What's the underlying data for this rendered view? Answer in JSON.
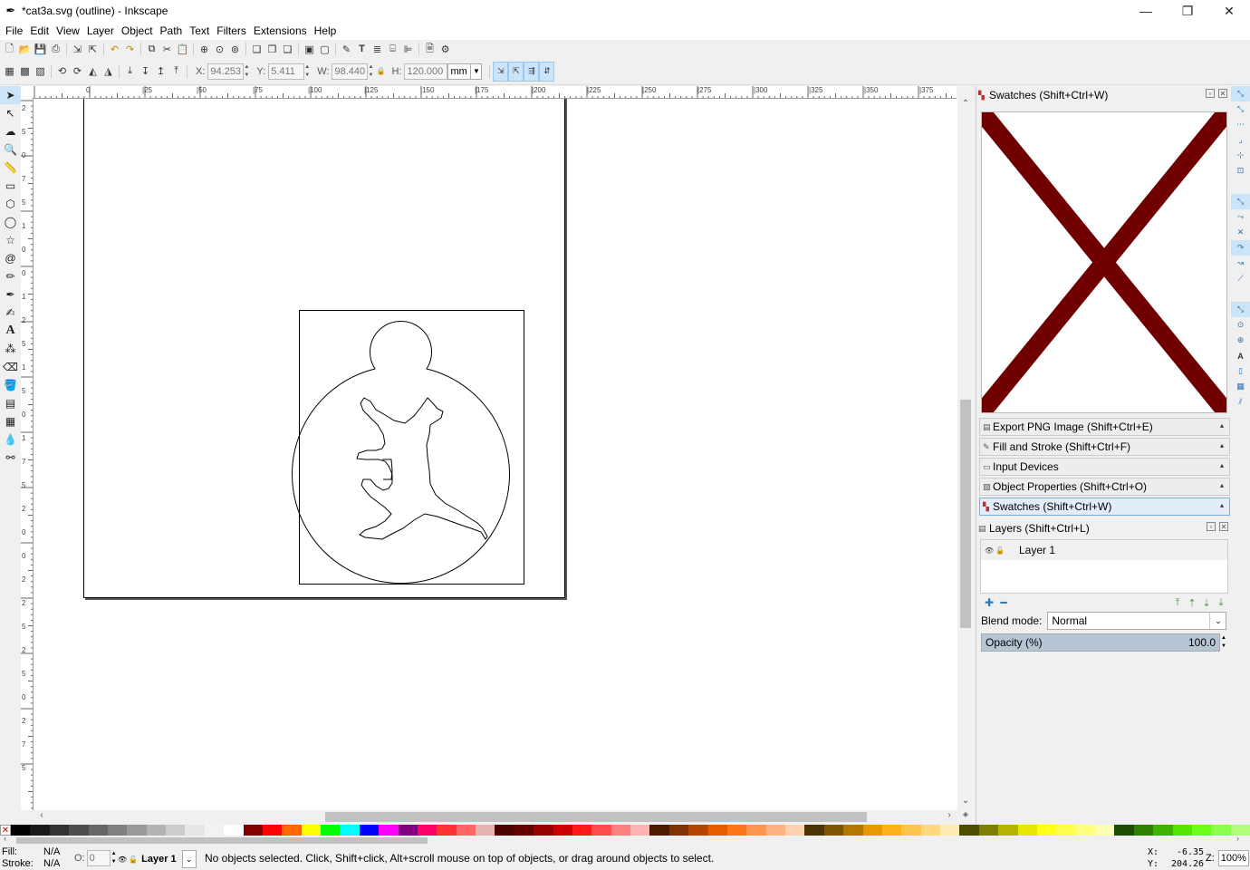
{
  "window": {
    "title": "*cat3a.svg (outline) - Inkscape",
    "app_icon": "inkscape-logo-icon",
    "controls": [
      "minimize-icon",
      "restore-icon",
      "close-icon"
    ]
  },
  "menubar": {
    "items": [
      {
        "label": "File",
        "accel": "F"
      },
      {
        "label": "Edit",
        "accel": "E"
      },
      {
        "label": "View",
        "accel": "V"
      },
      {
        "label": "Layer",
        "accel": "L"
      },
      {
        "label": "Object",
        "accel": "O"
      },
      {
        "label": "Path",
        "accel": "P"
      },
      {
        "label": "Text",
        "accel": "T"
      },
      {
        "label": "Filters",
        "accel": "r"
      },
      {
        "label": "Extensions",
        "accel": "x"
      },
      {
        "label": "Help",
        "accel": "H"
      }
    ]
  },
  "commandbar": {
    "icons": [
      "new-document-icon",
      "open-icon",
      "save-icon",
      "print-icon",
      "import-icon",
      "export-icon",
      "undo-icon",
      "redo-icon",
      "copy-icon",
      "cut-icon",
      "paste-icon",
      "zoom-selection-icon",
      "zoom-drawing-icon",
      "zoom-page-icon",
      "duplicate-icon",
      "clone-icon",
      "unlink-clone-icon",
      "group-icon",
      "ungroup-icon",
      "fill-stroke-icon",
      "text-font-icon",
      "layers-icon",
      "xml-editor-icon",
      "align-distribute-icon",
      "document-properties-icon",
      "preferences-icon"
    ]
  },
  "tool_controls": {
    "x_label": "X:",
    "x_value": "94.253",
    "y_label": "Y:",
    "y_value": "5.411",
    "w_label": "W:",
    "w_value": "98.440",
    "h_label": "H:",
    "h_value": "120.000",
    "unit": "mm"
  },
  "toolbox": {
    "tools": [
      "selector-tool-icon",
      "node-tool-icon",
      "tweak-tool-icon",
      "zoom-tool-icon",
      "measure-tool-icon",
      "rectangle-tool-icon",
      "3dbox-tool-icon",
      "ellipse-tool-icon",
      "star-tool-icon",
      "spiral-tool-icon",
      "pencil-tool-icon",
      "pen-tool-icon",
      "calligraphy-tool-icon",
      "text-tool-icon",
      "spray-tool-icon",
      "eraser-tool-icon",
      "paint-bucket-tool-icon",
      "gradient-tool-icon",
      "mesh-tool-icon",
      "dropper-tool-icon",
      "connector-tool-icon"
    ]
  },
  "ruler": {
    "h_labels": [
      "0",
      "|25",
      "|50",
      "|75",
      "|100",
      "|125",
      "|150",
      "|175",
      "|200",
      "|225",
      "|250",
      "|275",
      "|300",
      "|325",
      "|350",
      "|375"
    ],
    "v_labels": [
      "2",
      "5",
      "0",
      "7",
      "5",
      "1",
      "0",
      "0",
      "1",
      "2",
      "5",
      "1",
      "5",
      "0",
      "1",
      "7",
      "5",
      "2",
      "0",
      "0",
      "2",
      "2",
      "5",
      "2",
      "5",
      "0",
      "2",
      "7",
      "5"
    ]
  },
  "dock": {
    "swatches_title": "Swatches (Shift+Ctrl+W)",
    "collapsed_dialogs": [
      {
        "label": "Export PNG Image (Shift+Ctrl+E)",
        "icon": "export-png-icon"
      },
      {
        "label": "Fill and Stroke (Shift+Ctrl+F)",
        "icon": "fill-stroke-icon"
      },
      {
        "label": "Input Devices",
        "icon": "input-devices-icon"
      },
      {
        "label": "Object Properties (Shift+Ctrl+O)",
        "icon": "object-properties-icon"
      },
      {
        "label": "Swatches (Shift+Ctrl+W)",
        "icon": "swatches-icon"
      }
    ],
    "layers_title": "Layers (Shift+Ctrl+L)",
    "layers": [
      {
        "name": "Layer 1"
      }
    ],
    "blend_label": "Blend mode:",
    "blend_value": "Normal",
    "opacity_label": "Opacity (%)",
    "opacity_value": "100.0",
    "opacity_fraction": 1.0
  },
  "statusbar": {
    "fill_label": "Fill:",
    "stroke_label": "Stroke:",
    "fill_value": "N/A",
    "stroke_value": "N/A",
    "opacity_label": "O:",
    "opacity_value": "0",
    "layer_name": "Layer 1",
    "message": "No objects selected. Click, Shift+click, Alt+scroll mouse on top of objects, or drag around objects to select.",
    "x_label": "X:",
    "x_value": "-6.35",
    "y_label": "Y:",
    "y_value": "204.26",
    "zoom_label": "Z:",
    "zoom_value": "100%"
  },
  "palette": {
    "colors": [
      "#000000",
      "#1a1a1a",
      "#333333",
      "#4d4d4d",
      "#666666",
      "#808080",
      "#999999",
      "#b3b3b3",
      "#cccccc",
      "#e6e6e6",
      "#f2f2f2",
      "#ffffff",
      "#800000",
      "#ff0000",
      "#ff6600",
      "#ffff00",
      "#00ff00",
      "#00ffff",
      "#0000ff",
      "#ff00ff",
      "#800080",
      "#ff0066",
      "#ff3333",
      "#ff6666",
      "#e6b3b3",
      "#4d0000",
      "#660000",
      "#990000",
      "#cc0000",
      "#ff1a1a",
      "#ff4d4d",
      "#ff8080",
      "#ffb3b3",
      "#4d1a00",
      "#803300",
      "#b34700",
      "#e65c00",
      "#ff751a",
      "#ff944d",
      "#ffb380",
      "#ffd1b3",
      "#4d3300",
      "#805500",
      "#b37700",
      "#e69900",
      "#ffb31a",
      "#ffc64d",
      "#ffd980",
      "#ffecb3",
      "#4d4d00",
      "#808000",
      "#b3b300",
      "#e6e600",
      "#ffff1a",
      "#ffff4d",
      "#ffff80",
      "#ffffb3",
      "#1a4d00",
      "#2d8000",
      "#3fb300",
      "#52e600",
      "#6bff1a",
      "#8fff4d",
      "#b3ff80"
    ]
  }
}
